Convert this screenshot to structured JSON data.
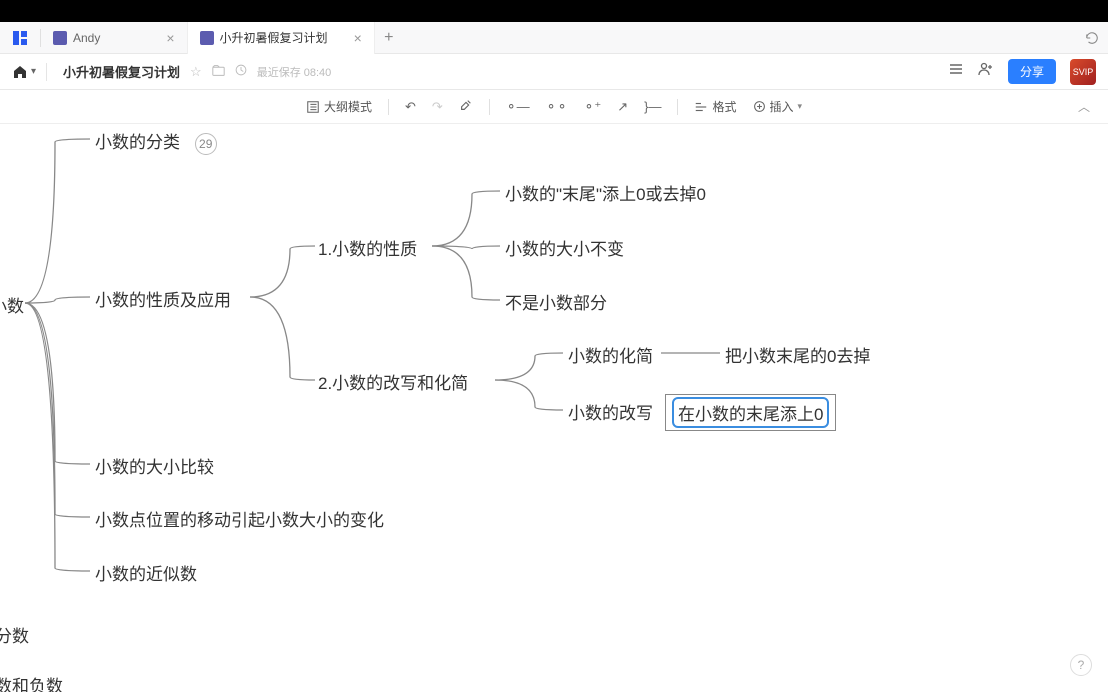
{
  "tabs": {
    "tab1": "Andy",
    "tab2": "小升初暑假复习计划"
  },
  "header": {
    "title": "小升初暑假复习计划",
    "save_label": "最近保存 08:40",
    "share_label": "分享",
    "avatar_text": "SVIP"
  },
  "toolbar": {
    "outline_mode": "大纲模式",
    "format": "格式",
    "insert": "插入"
  },
  "mindmap": {
    "root": "小数",
    "n1": "小数的分类",
    "n1_badge": "29",
    "n2": "小数的性质及应用",
    "n2_1": "1.小数的性质",
    "n2_1_1": "小数的\"末尾\"添上0或去掉0",
    "n2_1_2": "小数的大小不变",
    "n2_1_3": "不是小数部分",
    "n2_2": "2.小数的改写和化简",
    "n2_2_1": "小数的化简",
    "n2_2_1_1": "把小数末尾的0去掉",
    "n2_2_2": "小数的改写",
    "n2_2_2_1": "在小数的末尾添上0",
    "n3": "小数的大小比较",
    "n4": "小数点位置的移动引起小数大小的变化",
    "n5": "小数的近似数",
    "extra1": "分数",
    "extra2": "数和负数"
  }
}
